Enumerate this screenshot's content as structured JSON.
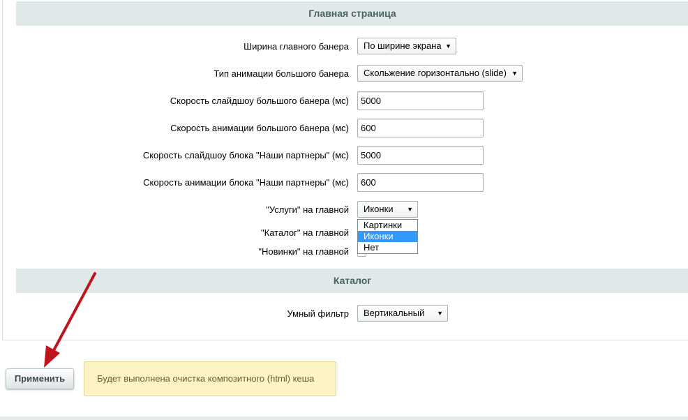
{
  "sections": {
    "main_page": {
      "title": "Главная страница"
    },
    "catalog": {
      "title": "Каталог"
    }
  },
  "fields": {
    "banner_width": {
      "label": "Ширина главного банера",
      "value": "По ширине экрана"
    },
    "banner_animation_type": {
      "label": "Тип анимации большого банера",
      "value": "Скольжение горизонтально (slide)"
    },
    "banner_slideshow_speed": {
      "label": "Скорость слайдшоу большого банера (мс)",
      "value": "5000"
    },
    "banner_animation_speed": {
      "label": "Скорость анимации большого банера (мс)",
      "value": "600"
    },
    "partners_slideshow_speed": {
      "label": "Скорость слайдшоу блока \"Наши партнеры\" (мс)",
      "value": "5000"
    },
    "partners_animation_speed": {
      "label": "Скорость анимации блока \"Наши партнеры\" (мс)",
      "value": "600"
    },
    "services_on_main": {
      "label": "\"Услуги\" на главной",
      "value": "Иконки"
    },
    "catalog_on_main": {
      "label": "\"Каталог\" на главной"
    },
    "news_on_main": {
      "label": "\"Новинки\" на главной"
    },
    "smart_filter": {
      "label": "Умный фильтр",
      "value": "Вертикальный"
    }
  },
  "services_dropdown": {
    "options": [
      "Картинки",
      "Иконки",
      "Нет"
    ],
    "selected_index": 1
  },
  "arrow_glyph": "▼",
  "actions": {
    "apply_label": "Применить"
  },
  "notice": {
    "text": "Будет выполнена очистка композитного (html) кеша"
  },
  "colors": {
    "header_bg": "#e0e8ea",
    "header_text": "#4b6267",
    "notice_bg": "#fdf4c6",
    "selected_option_bg": "#3399ff",
    "annotation_arrow": "#c0141b"
  },
  "icons": {
    "select_arrow": "triangle-down-icon",
    "annotation": "red-arrow-pointer"
  }
}
